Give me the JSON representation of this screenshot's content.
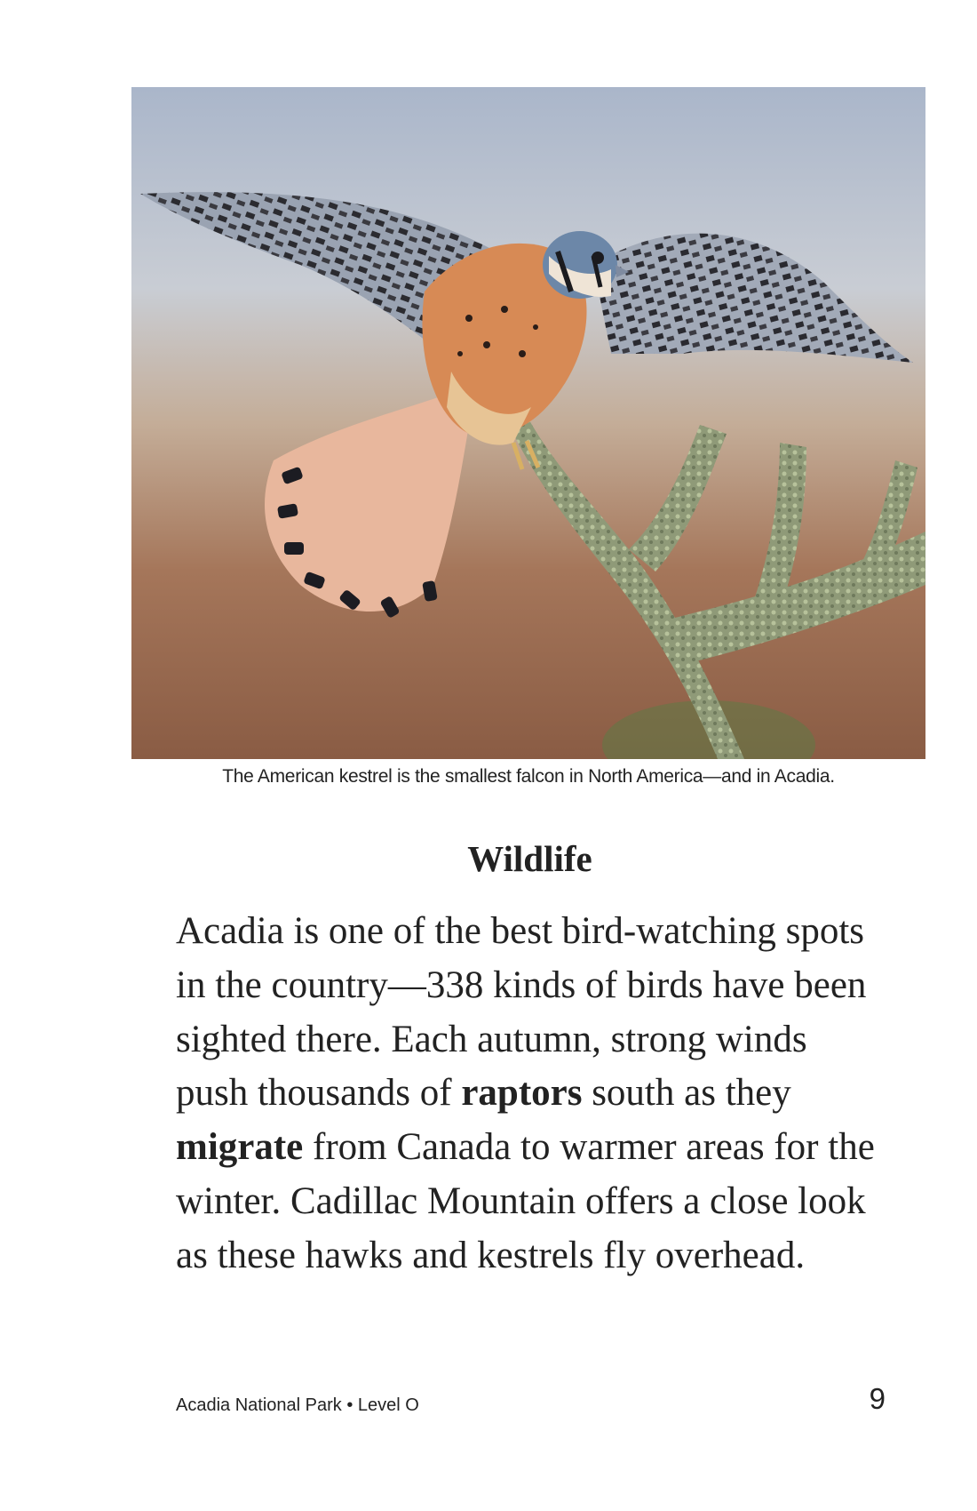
{
  "photo": {
    "subject": "american-kestrel-on-lichen-branch",
    "colors": {
      "sky": "#aeb9cc",
      "ground": "#8d5e44",
      "bird_body": "#d78a55",
      "wing": "#8f98a8",
      "lichen": "#a8b48a"
    }
  },
  "caption": "The American kestrel is the smallest falcon in North America—and in Acadia.",
  "heading": "Wildlife",
  "body": {
    "segments": [
      {
        "text": "Acadia is one of the best bird-watching spots in the country—338 kinds of birds have been sighted there. Each autumn, strong winds push thousands of "
      },
      {
        "text": "raptors",
        "bold": true
      },
      {
        "text": " south as they "
      },
      {
        "text": "migrate",
        "bold": true
      },
      {
        "text": " from Canada to warmer areas for the winter. Cadillac Mountain offers a close look as these hawks and kestrels fly overhead."
      }
    ]
  },
  "footer": {
    "book_title": "Acadia National Park • Level O",
    "page_number": "9"
  }
}
